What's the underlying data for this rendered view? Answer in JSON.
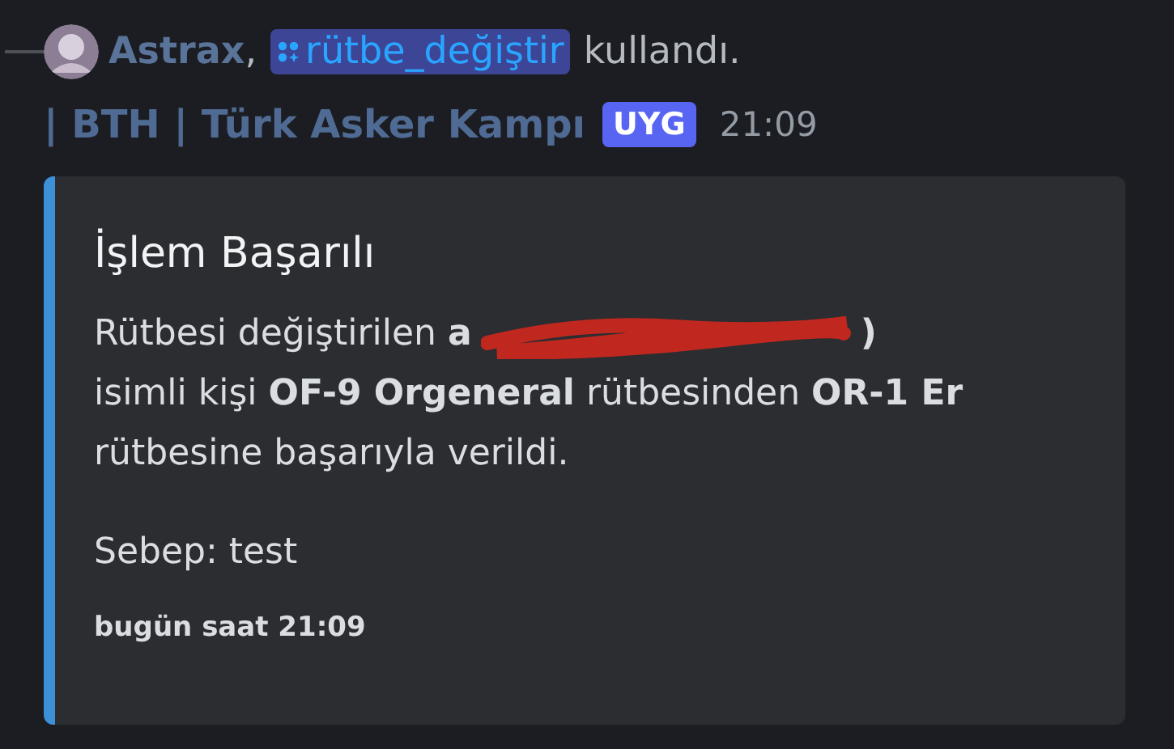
{
  "command_line": {
    "user": "Astrax",
    "separator": ",",
    "command": "rütbe_değiştir",
    "suffix": "kullandı."
  },
  "message": {
    "author": "| BTH | Türk Asker Kampı",
    "tag": "UYG",
    "time": "21:09"
  },
  "embed": {
    "color": "#3d8fd6",
    "title": "İşlem Başarılı",
    "description": {
      "before": "Rütbesi değiştirilen **a**",
      "redacted": true,
      "after": "**)**",
      "lines": [
        "isimli kişi **OF-9 Orgeneral** rütbesinden **OR-1 Er**",
        "rütbesine başarıyla verildi."
      ]
    },
    "reason": "Sebep: test",
    "footer": "bugün saat 21:09"
  }
}
